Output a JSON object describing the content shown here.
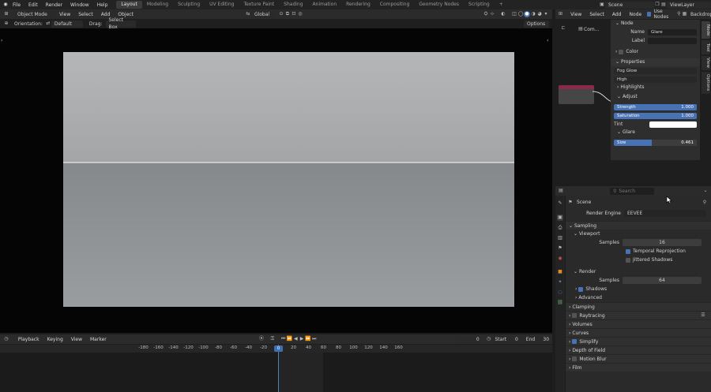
{
  "topbar": {
    "menus": [
      "File",
      "Edit",
      "Render",
      "Window",
      "Help"
    ],
    "workspaces": [
      "Layout",
      "Modeling",
      "Sculpting",
      "UV Editing",
      "Texture Paint",
      "Shading",
      "Animation",
      "Rendering",
      "Compositing",
      "Geometry Nodes",
      "Scripting"
    ],
    "active_workspace": "Layout",
    "add_tab": "+",
    "scene_label": "Scene",
    "view_layer_label": "ViewLayer"
  },
  "viewport_header": {
    "mode": "Object Mode",
    "menus": [
      "View",
      "Select",
      "Add",
      "Object"
    ],
    "transform": "Global"
  },
  "viewport_toolbar": {
    "orientation_label": "Orientation:",
    "orientation_value": "Default",
    "drag_label": "Drag:",
    "drag_value": "Select Box",
    "options_label": "Options"
  },
  "timeline": {
    "menus": [
      "Playback",
      "Keying",
      "View",
      "Marker"
    ],
    "current_frame": "0",
    "start_label": "Start",
    "start_value": "0",
    "end_label": "End",
    "end_value": "30",
    "playhead_label": "0",
    "ticks": [
      {
        "label": "-180",
        "value": -180
      },
      {
        "label": "-160",
        "value": -160
      },
      {
        "label": "-140",
        "value": -140
      },
      {
        "label": "-120",
        "value": -120
      },
      {
        "label": "-100",
        "value": -100
      },
      {
        "label": "-80",
        "value": -80
      },
      {
        "label": "-60",
        "value": -60
      },
      {
        "label": "-40",
        "value": -40
      },
      {
        "label": "-20",
        "value": -20
      },
      {
        "label": "20",
        "value": 20
      },
      {
        "label": "40",
        "value": 40
      },
      {
        "label": "60",
        "value": 60
      },
      {
        "label": "80",
        "value": 80
      },
      {
        "label": "100",
        "value": 100
      },
      {
        "label": "120",
        "value": 120
      },
      {
        "label": "140",
        "value": 140
      },
      {
        "label": "160",
        "value": 160
      }
    ]
  },
  "node_editor": {
    "menus": [
      "View",
      "Select",
      "Add",
      "Node"
    ],
    "use_nodes_label": "Use Nodes",
    "backdrop_label": "Backdrop",
    "tree_label": "Com...",
    "panel": {
      "node_section": "Node",
      "name_label": "Name",
      "name_value": "Glare",
      "label_label": "Label",
      "label_value": "",
      "color_label": "Color",
      "properties_section": "Properties",
      "glare_type": "Fog Glow",
      "quality": "High",
      "highlights_label": "Highlights",
      "adjust_label": "Adjust",
      "strength_label": "Strength",
      "strength_value": "1.000",
      "strength_fraction": 1.0,
      "saturation_label": "Saturation",
      "saturation_value": "1.000",
      "saturation_fraction": 1.0,
      "tint_label": "Tint",
      "glare_label": "Glare",
      "size_label": "Size",
      "size_value": "0.461",
      "size_fraction": 0.461
    },
    "tabs": [
      "Node",
      "Tool",
      "View",
      "Options"
    ]
  },
  "properties": {
    "search_placeholder": "Search",
    "scene_title": "Scene",
    "render_engine_label": "Render Engine",
    "render_engine_value": "EEVEE",
    "sampling": "Sampling",
    "viewport": "Viewport",
    "viewport_samples_label": "Samples",
    "viewport_samples_value": "16",
    "temporal_reprojection": "Temporal Reprojection",
    "jittered_shadows": "Jittered Shadows",
    "render": "Render",
    "render_samples_label": "Samples",
    "render_samples_value": "64",
    "shadows": "Shadows",
    "advanced": "Advanced",
    "clamping": "Clamping",
    "raytracing": "Raytracing",
    "volumes": "Volumes",
    "curves": "Curves",
    "simplify": "Simplify",
    "depth_of_field": "Depth of Field",
    "motion_blur": "Motion Blur",
    "film": "Film"
  },
  "colors": {
    "accent": "#4772b3",
    "node_header": "#8a2a4a"
  }
}
